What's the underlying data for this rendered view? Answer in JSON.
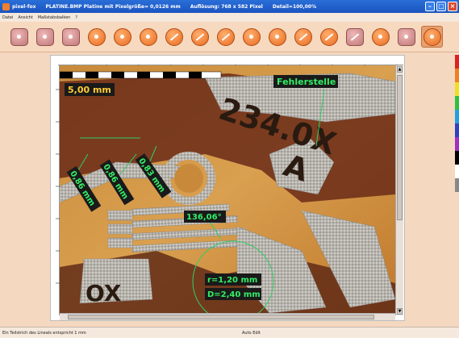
{
  "window": {
    "app_title": "pixel-fox",
    "file_title": "PLATINE.BMP Platine mit Pixelgröße= 0,0126 mm",
    "resolution": "Auflösung: 768 x 582 Pixel",
    "detail": "Detail=100,00%"
  },
  "menu": {
    "items": [
      "Datei",
      "Ansicht",
      "Maßstabsbalken",
      "?"
    ]
  },
  "toolbar": {
    "buttons": [
      {
        "icon": "capture-icon"
      },
      {
        "icon": "save-image-icon"
      },
      {
        "icon": "save-file-icon"
      },
      {
        "icon": "calibrate-icon"
      },
      {
        "icon": "scale-icon"
      },
      {
        "icon": "point-icon"
      },
      {
        "icon": "distance-icon"
      },
      {
        "icon": "parallel-line-icon"
      },
      {
        "icon": "angle-icon"
      },
      {
        "icon": "circle-icon"
      },
      {
        "icon": "polygon-icon"
      },
      {
        "icon": "line-icon"
      },
      {
        "icon": "pen-icon"
      },
      {
        "icon": "edit-icon"
      },
      {
        "icon": "zoom-icon"
      },
      {
        "icon": "export-icon"
      },
      {
        "icon": "settings-icon"
      }
    ]
  },
  "annotations": {
    "scale": "5,00 mm",
    "defect": "Fehlerstelle",
    "w1": "0,86 mm",
    "w2": "0,86 mm",
    "w3": "0,83 mm",
    "angle": "136,06°",
    "radius": "r=1,20 mm",
    "diameter": "D=2,40 mm"
  },
  "pcb_text": {
    "number": "234.0X",
    "letter": "A",
    "corner": "OX"
  },
  "status": {
    "left": "Ein Teilstrich des Lineals entspricht 1 mm",
    "middle": "Auto Edit"
  },
  "colors": {
    "accent": "#e86a20",
    "annotation": "#33cc66",
    "toolbar_bg": "#f7d9bf"
  }
}
